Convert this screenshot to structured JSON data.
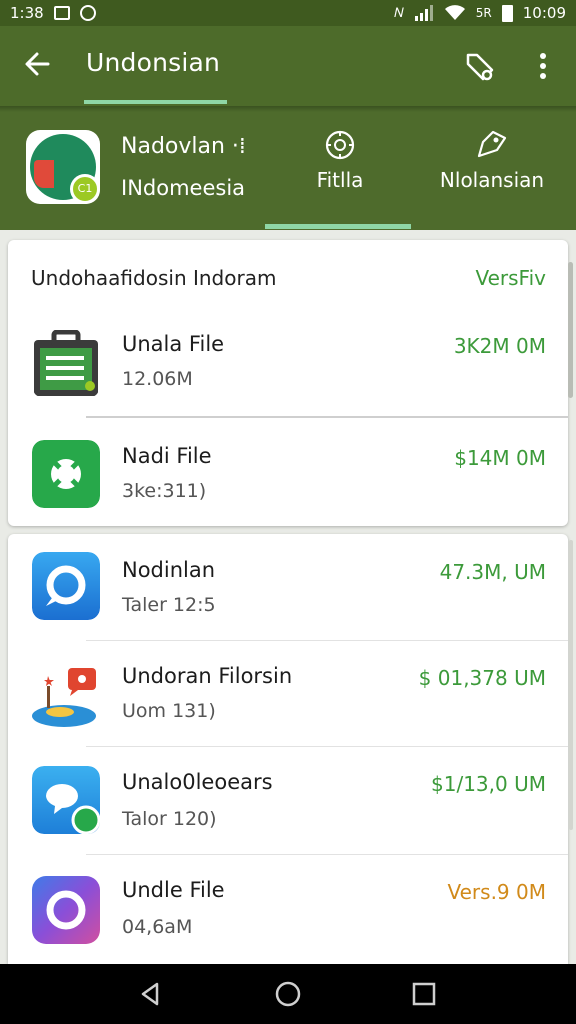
{
  "status_bar": {
    "time": "1:38",
    "signal_text": "5R",
    "clock_right": "10:09"
  },
  "app_bar": {
    "title": "Undonsian"
  },
  "header": {
    "name": "Nadovlan ·⁞",
    "subtitle": "INdomeesia",
    "tabs": [
      {
        "label": "Fitlla",
        "icon": "gear-icon"
      },
      {
        "label": "Nlolansian",
        "icon": "tag-icon"
      }
    ]
  },
  "card1": {
    "title": "Undohaafidosin Indoram",
    "action": "VersFiv",
    "items": [
      {
        "title": "Unala File",
        "subtitle": "12.06M",
        "price": "3K2M 0M",
        "color": "#3c9a3a",
        "icon": "clipboard-icon"
      },
      {
        "title": "Nadi File",
        "subtitle": "3ke:311)",
        "price": "$14M 0M",
        "color": "#3c9a3a",
        "icon": "green-cross-icon"
      }
    ]
  },
  "card2": {
    "items": [
      {
        "title": "Nodinlan",
        "subtitle": "Taler 12:5",
        "price": "47.3M, UM",
        "color": "#3c9a3a",
        "icon": "blue-chat-icon"
      },
      {
        "title": "Undoran Filorsin",
        "subtitle": "Uom 131)",
        "price": "$ 01,378 UM",
        "color": "#3c9a3a",
        "icon": "island-icon"
      },
      {
        "title": "Unalo0leoears",
        "subtitle": "Talor 120)",
        "price": "$1/13,0 UM",
        "color": "#3c9a3a",
        "icon": "messenger-icon"
      },
      {
        "title": "Undle File",
        "subtitle": "04,6aM",
        "price": "Vers.9 0M",
        "color": "#d18a1a",
        "icon": "purple-circle-icon"
      }
    ]
  }
}
